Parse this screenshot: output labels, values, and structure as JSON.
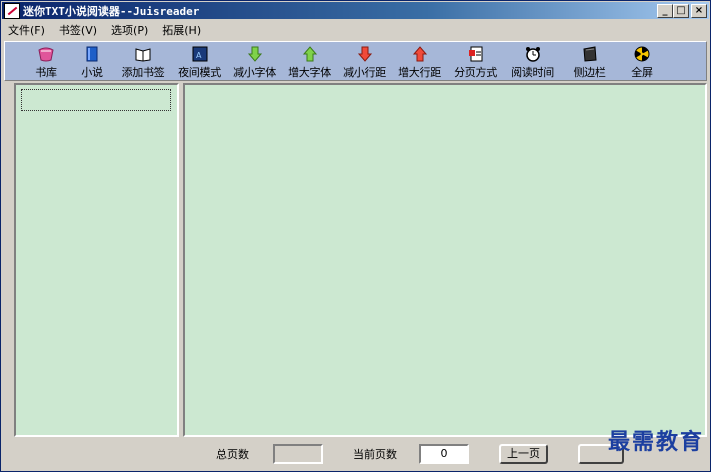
{
  "window": {
    "title": "迷你TXT小说阅读器--Juisreader"
  },
  "menu": [
    "文件(F)",
    "书签(V)",
    "选项(P)",
    "拓展(H)"
  ],
  "toolbar": [
    {
      "label": "书库",
      "icon": "bookshelf-icon"
    },
    {
      "label": "小说",
      "icon": "novel-book-icon"
    },
    {
      "label": "添加书签",
      "icon": "add-bookmark-icon"
    },
    {
      "label": "夜间模式",
      "icon": "night-mode-icon"
    },
    {
      "label": "减小字体",
      "icon": "arrow-down-green-icon"
    },
    {
      "label": "增大字体",
      "icon": "arrow-up-green-icon"
    },
    {
      "label": "减小行距",
      "icon": "arrow-down-red-icon"
    },
    {
      "label": "增大行距",
      "icon": "arrow-up-red-icon"
    },
    {
      "label": "分页方式",
      "icon": "page-mode-icon"
    },
    {
      "label": "阅读时间",
      "icon": "alarm-clock-icon"
    },
    {
      "label": "侧边栏",
      "icon": "sidebar-icon"
    },
    {
      "label": "全屏",
      "icon": "fullscreen-icon"
    }
  ],
  "status": {
    "total_pages_label": "总页数",
    "current_page_label": "当前页数",
    "current_page_value": "0",
    "prev_button": "上一页"
  },
  "watermark": "最需教育",
  "colors": {
    "toolbar_bg": "#a6b7d8",
    "reader_bg": "#cce8d1",
    "title_bar": "#0a246a"
  }
}
